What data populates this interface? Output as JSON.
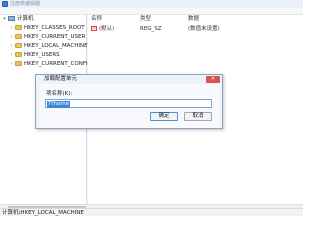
{
  "window": {
    "title": "注册表编辑器"
  },
  "tree": {
    "root_label": "计算机",
    "items": [
      {
        "label": "HKEY_CLASSES_ROOT"
      },
      {
        "label": "HKEY_CURRENT_USER"
      },
      {
        "label": "HKEY_LOCAL_MACHINE"
      },
      {
        "label": "HKEY_USERS"
      },
      {
        "label": "HKEY_CURRENT_CONFIG"
      }
    ]
  },
  "values": {
    "columns": [
      "名称",
      "类型",
      "数据"
    ],
    "rows": [
      {
        "name": "(默认)",
        "type": "REG_SZ",
        "data": "(数值未设置)"
      }
    ]
  },
  "dialog": {
    "title": "加载配置单元",
    "field_label": "项名称(K):",
    "field_value": "Tthome",
    "ok_label": "确定",
    "cancel_label": "取消",
    "close_icon": "close-icon"
  },
  "statusbar": {
    "path": "计算机\\HKEY_LOCAL_MACHINE"
  },
  "colors": {
    "accent": "#3f86d6",
    "close": "#d9534f",
    "folder": "#e8c35a"
  }
}
